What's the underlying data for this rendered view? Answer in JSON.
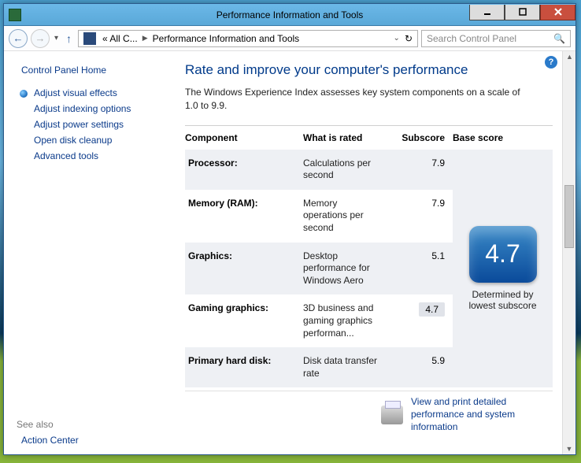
{
  "window": {
    "title": "Performance Information and Tools"
  },
  "address": {
    "seg1": "« All C...",
    "seg2": "Performance Information and Tools"
  },
  "search": {
    "placeholder": "Search Control Panel"
  },
  "sidebar": {
    "home": "Control Panel Home",
    "links": [
      "Adjust visual effects",
      "Adjust indexing options",
      "Adjust power settings",
      "Open disk cleanup",
      "Advanced tools"
    ],
    "see_also": "See also",
    "action_center": "Action Center"
  },
  "page": {
    "title": "Rate and improve your computer's performance",
    "desc": "The Windows Experience Index assesses key system components on a scale of 1.0 to 9.9."
  },
  "table": {
    "headers": {
      "component": "Component",
      "rated": "What is rated",
      "subscore": "Subscore",
      "base": "Base score"
    },
    "rows": [
      {
        "comp": "Processor:",
        "rated": "Calculations per second",
        "sub": "7.9",
        "hi": false
      },
      {
        "comp": "Memory (RAM):",
        "rated": "Memory operations per second",
        "sub": "7.9",
        "hi": false
      },
      {
        "comp": "Graphics:",
        "rated": "Desktop performance for Windows Aero",
        "sub": "5.1",
        "hi": false
      },
      {
        "comp": "Gaming graphics:",
        "rated": "3D business and gaming graphics performan...",
        "sub": "4.7",
        "hi": true
      },
      {
        "comp": "Primary hard disk:",
        "rated": "Disk data transfer rate",
        "sub": "5.9",
        "hi": false
      }
    ],
    "base_score": "4.7",
    "base_note": "Determined by lowest subscore"
  },
  "footer_link": "View and print detailed performance and system information"
}
